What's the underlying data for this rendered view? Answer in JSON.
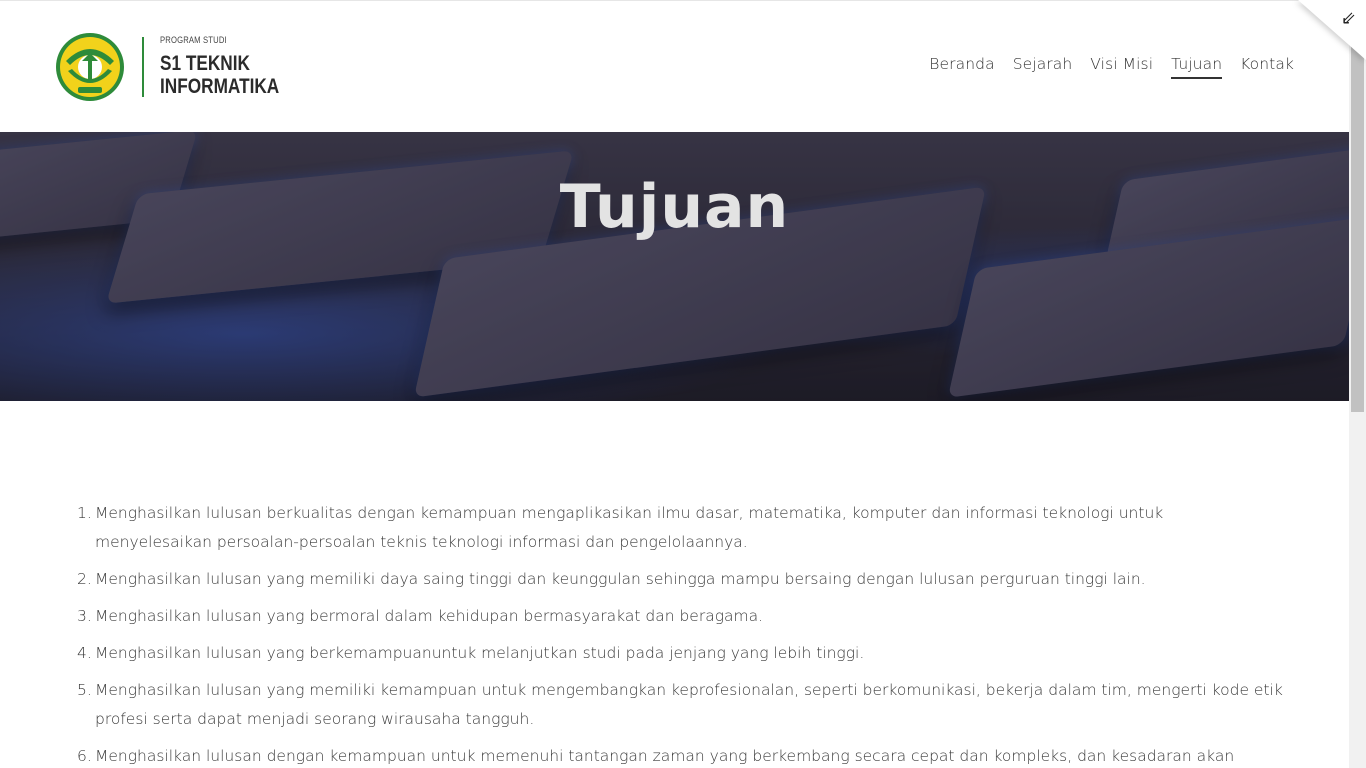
{
  "brand": {
    "small": "PROGRAM STUDI",
    "line1": "S1 TEKNIK",
    "line2": "INFORMATIKA",
    "logo_icon": "university-emblem-icon"
  },
  "nav": {
    "items": [
      {
        "label": "Beranda"
      },
      {
        "label": "Sejarah"
      },
      {
        "label": "Visi Misi"
      },
      {
        "label": "Tujuan",
        "active": true
      },
      {
        "label": "Kontak"
      }
    ]
  },
  "corner": {
    "icon": "exit-fullscreen-icon",
    "glyph": "⇙"
  },
  "hero": {
    "title": "Tujuan"
  },
  "goals": [
    {
      "num": "1.",
      "text": "Menghasilkan lulusan berkualitas dengan kemampuan mengaplikasikan ilmu dasar, matematika, komputer dan informasi teknologi untuk menyelesaikan persoalan-persoalan teknis teknologi informasi dan pengelolaannya."
    },
    {
      "num": "2.",
      "text": "Menghasilkan lulusan yang memiliki daya saing tinggi dan keunggulan sehingga mampu bersaing dengan lulusan perguruan tinggi lain."
    },
    {
      "num": "3.",
      "text": "Menghasilkan lulusan yang bermoral dalam kehidupan bermasyarakat dan beragama."
    },
    {
      "num": "4.",
      "text": "Menghasilkan lulusan yang berkemampuanuntuk melanjutkan studi pada jenjang yang lebih tinggi."
    },
    {
      "num": "5.",
      "text": "Menghasilkan lulusan yang memiliki kemampuan untuk mengembangkan keprofesionalan, seperti berkomunikasi, bekerja dalam tim, mengerti kode etik profesi serta dapat menjadi seorang wirausaha tangguh."
    },
    {
      "num": "6.",
      "text": "Menghasilkan lulusan dengan kemampuan untuk memenuhi tantangan zaman yang berkembang secara cepat dan kompleks, dan kesadaran akan"
    }
  ],
  "colors": {
    "accent_green": "#2e8b3a",
    "logo_yellow": "#f2d21b",
    "text": "#333333"
  }
}
